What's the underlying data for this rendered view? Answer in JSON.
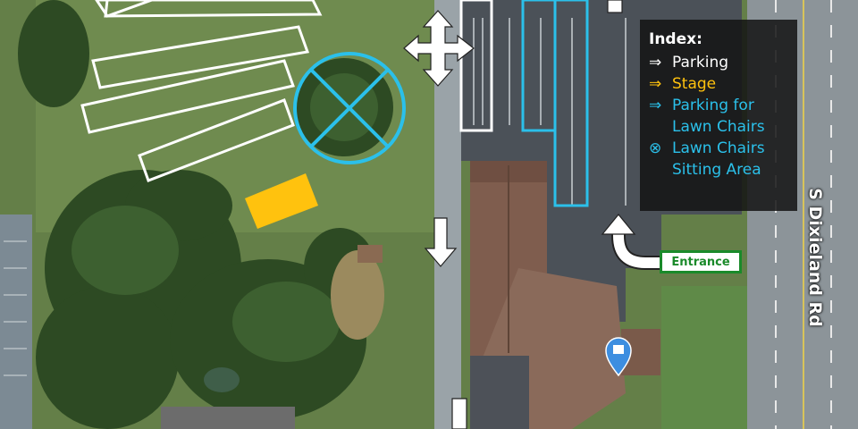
{
  "legend": {
    "title": "Index:",
    "items": [
      {
        "symbol": "⇒",
        "label": "Parking",
        "color": "#ffffff"
      },
      {
        "symbol": "⇒",
        "label": "Stage",
        "color": "#ffc20e"
      },
      {
        "symbol": "⇒",
        "label": "Parking for Lawn Chairs",
        "color": "#2bc0ea"
      },
      {
        "symbol": "⊗",
        "label": "Lawn Chairs Sitting Area",
        "color": "#2bc0ea"
      }
    ]
  },
  "labels": {
    "entrance": "Entrance",
    "road": "S Dixieland Rd"
  },
  "icons": [
    "location-pin-icon",
    "arrow-icon"
  ],
  "colors": {
    "parking": "#ffffff",
    "stage": "#ffc20e",
    "lawn_chairs": "#2bc0ea",
    "entrance_border": "#1a8a2a",
    "pin": "#3d8ee0"
  }
}
